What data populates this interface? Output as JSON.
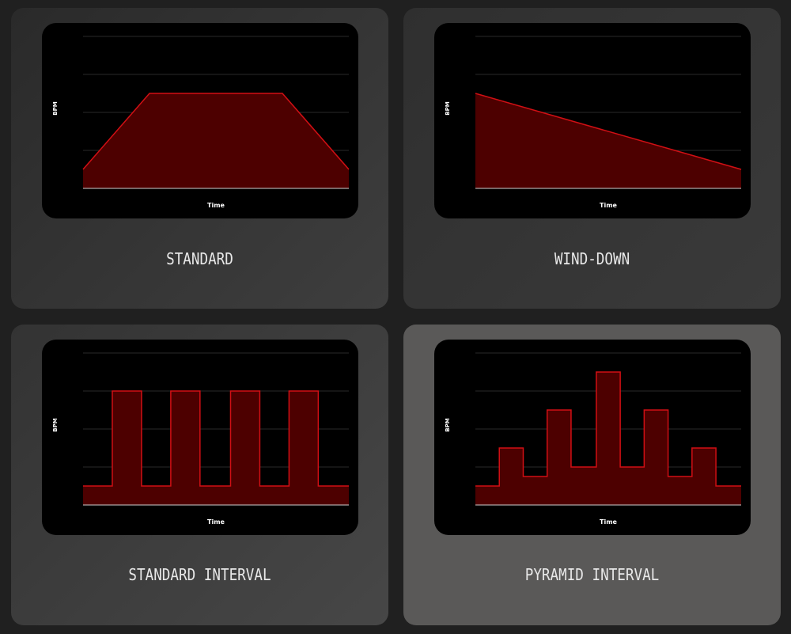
{
  "colors": {
    "line": "#d10f14",
    "fill": "#4d0000",
    "grid": "#2a2a2a",
    "baseline": "#cfcfcf"
  },
  "cards": [
    {
      "label": "STANDARD"
    },
    {
      "label": "WIND-DOWN"
    },
    {
      "label": "STANDARD INTERVAL"
    },
    {
      "label": "PYRAMID INTERVAL"
    }
  ],
  "chart_data": [
    {
      "type": "area",
      "xlabel": "Time",
      "ylabel": "BPM",
      "ylim": [
        0,
        4
      ],
      "x": [
        0,
        0.25,
        0.75,
        1
      ],
      "y": [
        0.5,
        2.5,
        2.5,
        0.5
      ]
    },
    {
      "type": "area",
      "xlabel": "Time",
      "ylabel": "BPM",
      "ylim": [
        0,
        4
      ],
      "x": [
        0,
        1
      ],
      "y": [
        2.5,
        0.5
      ]
    },
    {
      "type": "area",
      "xlabel": "Time",
      "ylabel": "BPM",
      "ylim": [
        0,
        4
      ],
      "step": true,
      "x": [
        0,
        0.11,
        0.22,
        0.33,
        0.44,
        0.555,
        0.665,
        0.775,
        0.885,
        1
      ],
      "y": [
        0.5,
        3,
        0.5,
        3,
        0.5,
        3,
        0.5,
        3,
        0.5,
        0.5
      ]
    },
    {
      "type": "area",
      "xlabel": "Time",
      "ylabel": "BPM",
      "ylim": [
        0,
        4
      ],
      "step": true,
      "x": [
        0,
        0.09,
        0.18,
        0.27,
        0.36,
        0.455,
        0.545,
        0.635,
        0.725,
        0.815,
        0.905,
        1
      ],
      "y": [
        0.5,
        1.5,
        0.75,
        2.5,
        1,
        3.5,
        1,
        2.5,
        0.75,
        1.5,
        0.5,
        0.5
      ]
    }
  ]
}
